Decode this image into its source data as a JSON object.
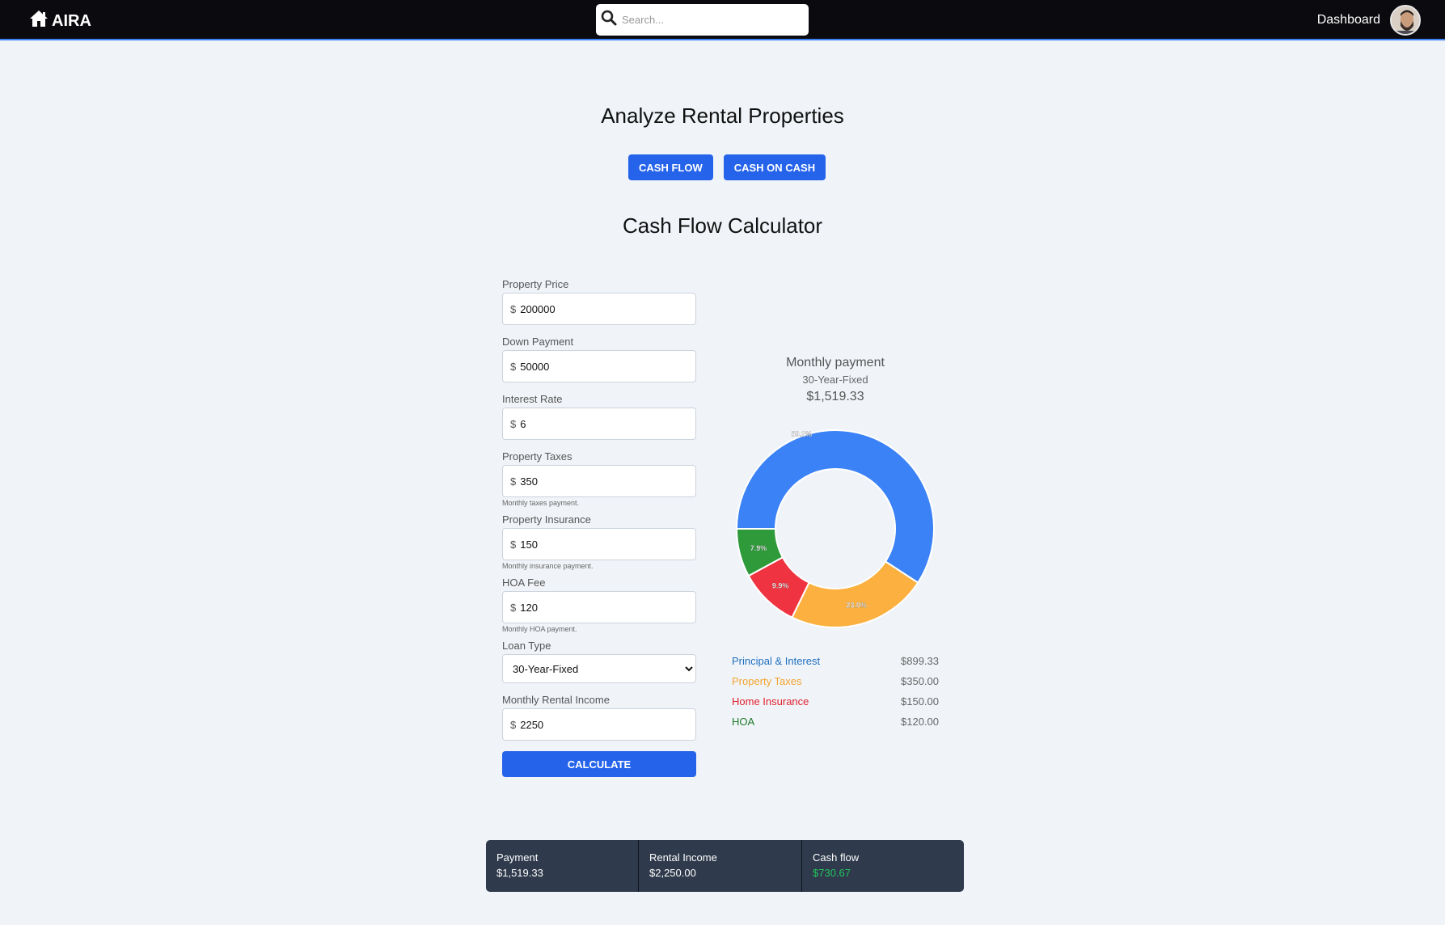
{
  "navbar": {
    "brand": "AIRA",
    "search_placeholder": "Search...",
    "dashboard_label": "Dashboard"
  },
  "page": {
    "title": "Analyze Rental Properties",
    "tabs": [
      {
        "label": "CASH FLOW"
      },
      {
        "label": "CASH ON CASH"
      }
    ],
    "calculator_title": "Cash Flow Calculator"
  },
  "form": {
    "currency_symbol": "$",
    "property_price": {
      "label": "Property Price",
      "value": "200000"
    },
    "down_payment": {
      "label": "Down Payment",
      "value": "50000"
    },
    "interest_rate": {
      "label": "Interest Rate",
      "value": "6"
    },
    "property_taxes": {
      "label": "Property Taxes",
      "value": "350",
      "hint": "Monthly taxes payment."
    },
    "property_insurance": {
      "label": "Property Insurance",
      "value": "150",
      "hint": "Monthly insurance payment."
    },
    "hoa_fee": {
      "label": "HOA Fee",
      "value": "120",
      "hint": "Monthly HOA payment."
    },
    "loan_type": {
      "label": "Loan Type",
      "selected": "30-Year-Fixed"
    },
    "monthly_rental_income": {
      "label": "Monthly Rental Income",
      "value": "2250"
    },
    "calculate_label": "CALCULATE"
  },
  "chart_header": {
    "title": "Monthly payment",
    "subtitle": "30-Year-Fixed",
    "amount": "$1,519.33"
  },
  "chart_data": {
    "type": "pie",
    "categories": [
      "Principal & Interest",
      "Property Taxes",
      "Home Insurance",
      "HOA"
    ],
    "values": [
      899.33,
      350.0,
      150.0,
      120.0
    ],
    "labels": [
      "59.2%",
      "23.0%",
      "9.9%",
      "7.9%"
    ],
    "colors": [
      "#3b82f6",
      "#fbb040",
      "#ef3340",
      "#2e9a3a"
    ]
  },
  "legend": [
    {
      "label": "Principal & Interest",
      "value": "$899.33",
      "color": "#1f6fbf"
    },
    {
      "label": "Property Taxes",
      "value": "$350.00",
      "color": "#f3a42d"
    },
    {
      "label": "Home Insurance",
      "value": "$150.00",
      "color": "#e0202c"
    },
    {
      "label": "HOA",
      "value": "$120.00",
      "color": "#1f7a2a"
    }
  ],
  "summary": {
    "payment": {
      "label": "Payment",
      "value": "$1,519.33"
    },
    "rental_income": {
      "label": "Rental Income",
      "value": "$2,250.00"
    },
    "cash_flow": {
      "label": "Cash flow",
      "value": "$730.67",
      "color": "#22c55e"
    }
  }
}
